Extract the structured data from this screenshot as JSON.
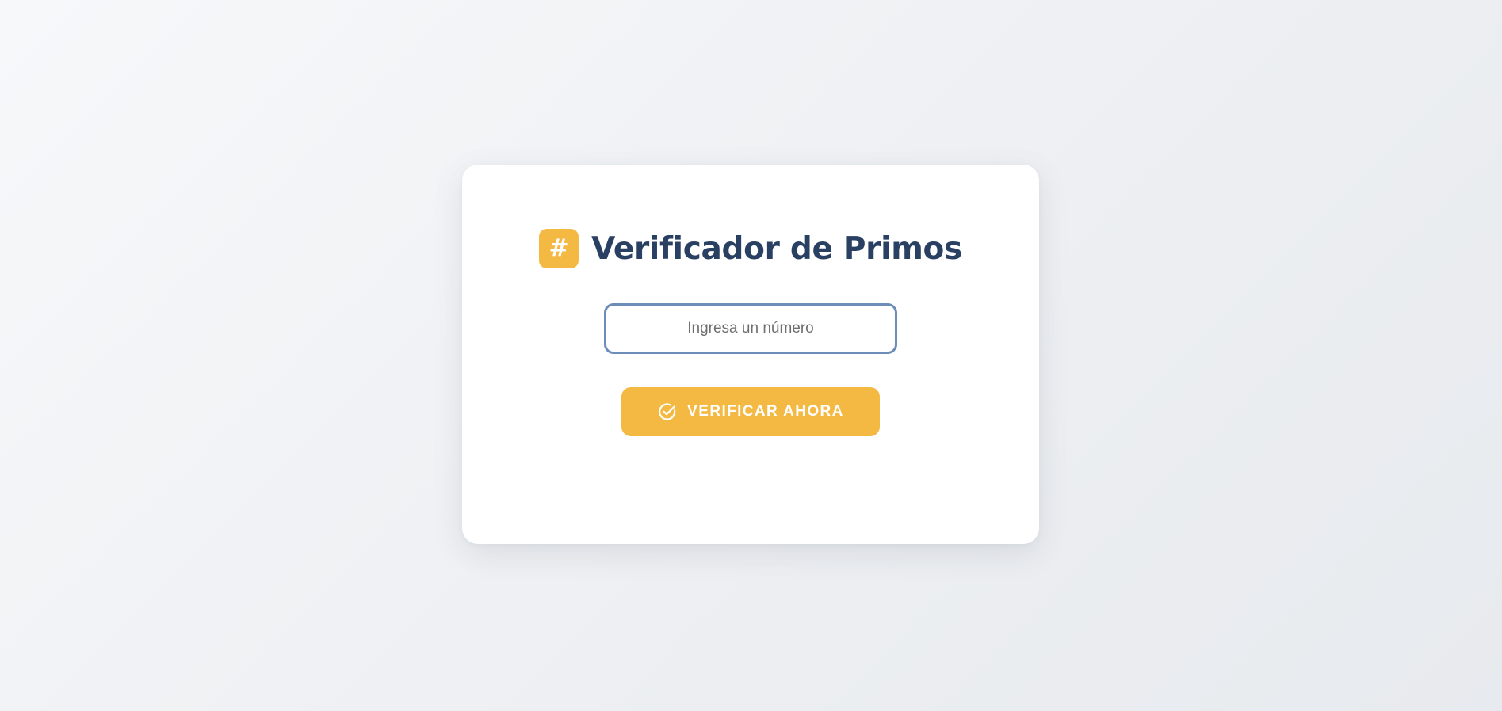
{
  "app": {
    "title": "Verificador de Primos",
    "badge_symbol": "#"
  },
  "input": {
    "placeholder": "Ingresa un número",
    "value": ""
  },
  "button": {
    "label": "VERIFICAR AHORA",
    "icon": "check-circle-icon"
  },
  "colors": {
    "accent": "#f4b942",
    "title": "#2a4063",
    "input_border": "#6b8db7",
    "card": "#ffffff"
  }
}
